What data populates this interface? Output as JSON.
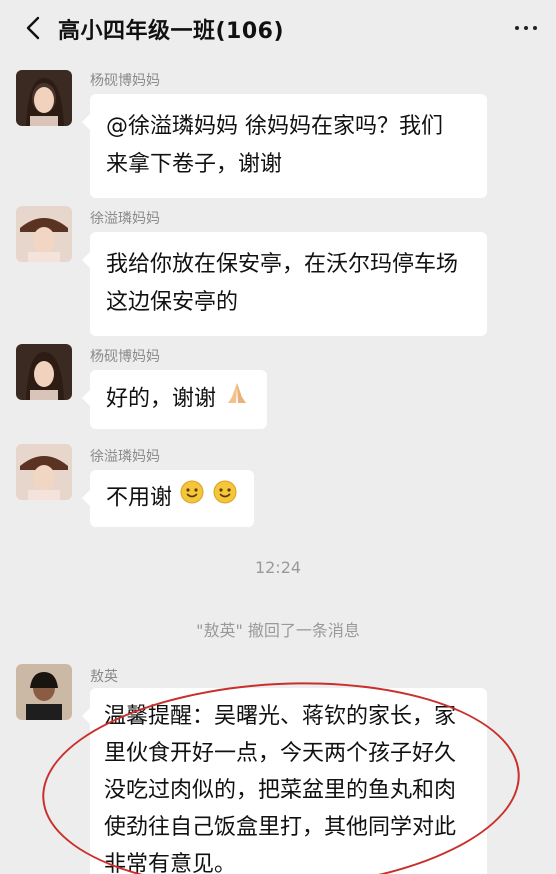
{
  "header": {
    "title": "高小四年级一班(106)"
  },
  "messages": [
    {
      "sender": "杨砚博妈妈",
      "text_lines": [
        "@徐溢璘妈妈  徐妈妈在家吗？我们",
        "来拿下卷子，谢谢"
      ]
    },
    {
      "sender": "徐溢璘妈妈",
      "text_lines": [
        "我给你放在保安亭，在沃尔玛停车场",
        "这边保安亭的"
      ]
    },
    {
      "sender": "杨砚博妈妈",
      "text": "好的，谢谢"
    },
    {
      "sender": "徐溢璘妈妈",
      "text": "不用谢"
    },
    {
      "sender": "敖英",
      "text_lines": [
        "温馨提醒：吴曙光、蒋钦的家长，家",
        "里伙食开好一点，今天两个孩子好久",
        "没吃过肉似的，把菜盆里的鱼丸和肉",
        "使劲往自己饭盒里打，其他同学对此",
        "非常有意见。"
      ]
    }
  ],
  "system": {
    "time": "12:24",
    "recall_notice": "\"敖英\" 撤回了一条消息"
  },
  "colors": {
    "background": "#ededed",
    "bubble": "#ffffff",
    "annotation_circle": "#c9302c"
  },
  "icons": {
    "back": "chevron-left-icon",
    "more": "more-dots-icon",
    "pray": "praying-hands-icon",
    "smile": "smile-emoji-icon"
  }
}
